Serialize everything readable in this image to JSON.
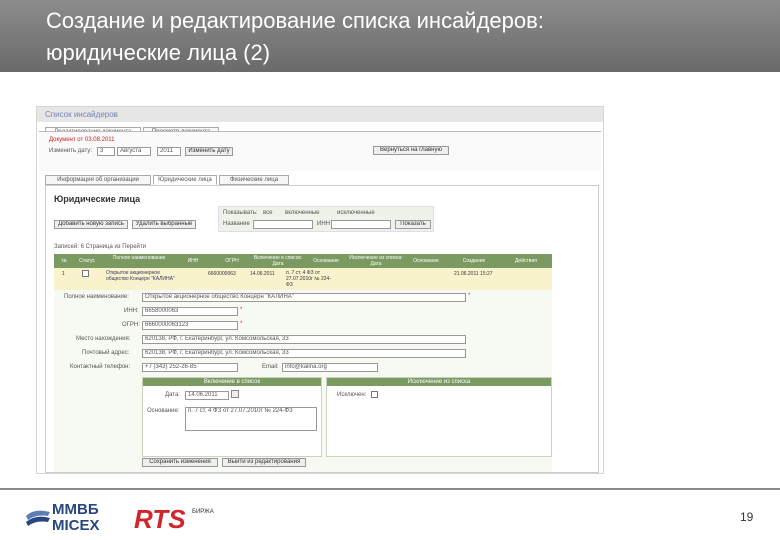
{
  "slide": {
    "title_line1": "Создание  и редактирование списка инсайдеров:",
    "title_line2": "юридические лица (2)",
    "page_number": "19"
  },
  "app": {
    "list_title": "Список инсайдеров",
    "tabs": [
      "Редактирование документа",
      "Просмотр документа"
    ],
    "doc_date_label": "Документ от 03.08.2011",
    "change_date_label": "Изменить дату:",
    "day": "3",
    "month": "Августа",
    "year": "2011",
    "change_date_button": "Изменить дату",
    "back_button": "Вернуться на главную",
    "subtabs": [
      "Информация об организации",
      "Юридические лица",
      "Физические лица"
    ],
    "section_title": "Юридические лица",
    "add_button": "Добавить новую запись",
    "delete_button": "Удалить выбранные",
    "filter_show_label": "Показывать:",
    "filter_options": [
      "все",
      "включенные",
      "исключенные"
    ],
    "filter_name_label": "Название",
    "filter_inn_label": "ИНН",
    "search_button": "Показать",
    "pagination_text": "Записей: 6   Страница  из  Перейти",
    "table_headers": [
      "№",
      "Статус",
      "Полное наименование",
      "ИНН",
      "ОГРН",
      "Включение в список: Дата",
      "Основание",
      "Исключение из списка: Дата",
      "Основание",
      "Создание",
      "Действия"
    ],
    "row": {
      "num": "1",
      "name": "Открытое акционерное общество Концерн \"КАЛИНА\"",
      "ogrn": "6660000063",
      "include_date": "14.06.2011",
      "include_basis": "п. 7 ст. 4 ФЗ от 27.07.2010г № 224-ФЗ",
      "created": "21.06.2011 15:27"
    },
    "form": {
      "full_name_label": "Полное наименование:",
      "full_name_value": "Открытое акционерное общество Концерн \"КАЛИНА\"",
      "inn_label": "ИНН:",
      "inn_value": "6658000063",
      "ogrn_label": "ОГРН:",
      "ogrn_value": "6660000063123",
      "location_label": "Место нахождения:",
      "location_value": "620138, РФ, г. Екатеринбург, ул. Комсомольская, 33",
      "postal_label": "Почтовый адрес:",
      "postal_value": "620138, РФ, г. Екатеринбург, ул. Комсомольская, 33",
      "phone_label": "Контактный телефон:",
      "phone_value": "+7 (343) 252-26-85",
      "email_label": "Email:",
      "email_value": "info@kalina.org",
      "include_header": "Включение в список",
      "exclude_header": "Исключение из списка",
      "date_label": "Дата:",
      "date_value": "14.06.2011",
      "basis_label": "Основание:",
      "basis_value": "п. 7 ст. 4 ФЗ от 27.07.2010г № 224-ФЗ",
      "exclusion_label": "Исключен:",
      "save_button": "Сохранить изменения",
      "exit_button": "Выйти из редактирования"
    }
  },
  "logos": {
    "mmvb_top": "ММВБ",
    "mmvb_bottom": "MICEX",
    "rts": "RTS",
    "birzha": "БИРЖА"
  },
  "colors": {
    "header_bg": "#7a7a7a",
    "table_header_green": "#7a9a62",
    "row_highlight": "#f9f3cd",
    "rts_red": "#d0262b",
    "mmvb_blue": "#27477e"
  }
}
